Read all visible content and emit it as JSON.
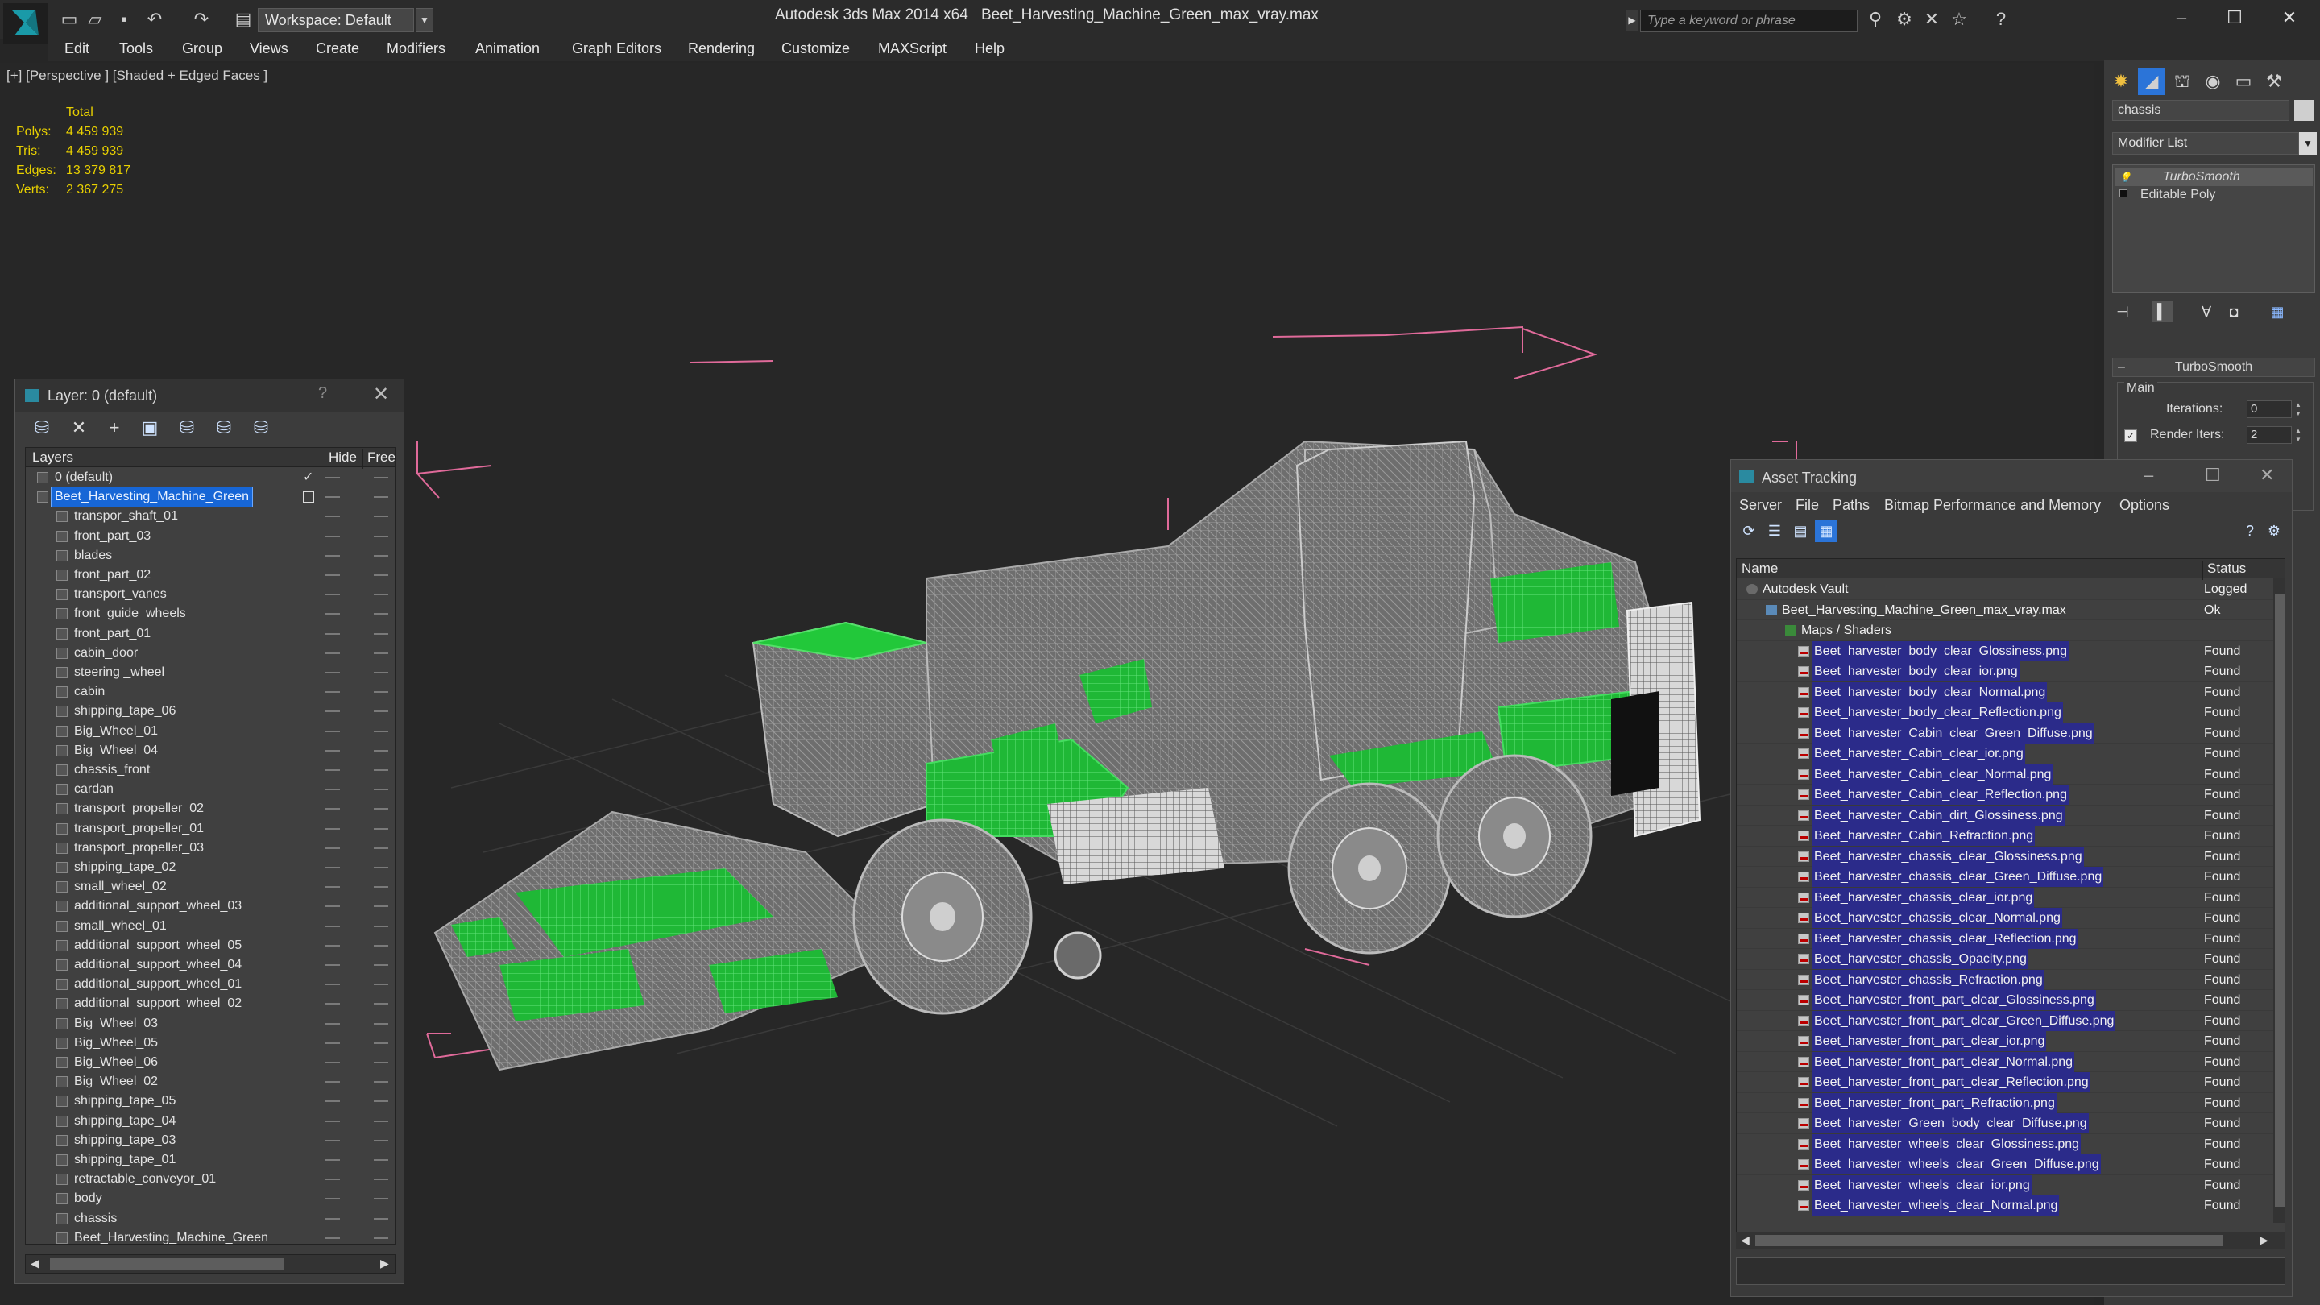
{
  "titlebar": {
    "workspace": "Workspace: Default",
    "app_title": "Autodesk 3ds Max  2014 x64",
    "file_title": "Beet_Harvesting_Machine_Green_max_vray.max",
    "search_placeholder": "Type a keyword or phrase"
  },
  "menu": [
    "Edit",
    "Tools",
    "Group",
    "Views",
    "Create",
    "Modifiers",
    "Animation",
    "Graph Editors",
    "Rendering",
    "Customize",
    "MAXScript",
    "Help"
  ],
  "viewport": {
    "label": "[+] [Perspective ] [Shaded + Edged Faces ]",
    "stats": {
      "header": "Total",
      "rows": [
        {
          "k": "Polys:",
          "v": "4 459 939"
        },
        {
          "k": "Tris:",
          "v": "4 459 939"
        },
        {
          "k": "Edges:",
          "v": "13 379 817"
        },
        {
          "k": "Verts:",
          "v": "2 367 275"
        }
      ]
    }
  },
  "layer_panel": {
    "title": "Layer: 0 (default)",
    "help": "?",
    "columns": {
      "layers": "Layers",
      "hide": "Hide",
      "freeze": "Free:"
    },
    "default_layer": "0 (default)",
    "selected_layer": "Beet_Harvesting_Machine_Green",
    "objects": [
      "transpor_shaft_01",
      "front_part_03",
      "blades",
      "front_part_02",
      "transport_vanes",
      "front_guide_wheels",
      "front_part_01",
      "cabin_door",
      "steering _wheel",
      "cabin",
      "shipping_tape_06",
      "Big_Wheel_01",
      "Big_Wheel_04",
      "chassis_front",
      "cardan",
      "transport_propeller_02",
      "transport_propeller_01",
      "transport_propeller_03",
      "shipping_tape_02",
      "small_wheel_02",
      "additional_support_wheel_03",
      "small_wheel_01",
      "additional_support_wheel_05",
      "additional_support_wheel_04",
      "additional_support_wheel_01",
      "additional_support_wheel_02",
      "Big_Wheel_03",
      "Big_Wheel_05",
      "Big_Wheel_06",
      "Big_Wheel_02",
      "shipping_tape_05",
      "shipping_tape_04",
      "shipping_tape_03",
      "shipping_tape_01",
      "retractable_conveyor_01",
      "body",
      "chassis",
      "Beet_Harvesting_Machine_Green"
    ]
  },
  "command_panel": {
    "object_name": "chassis",
    "modifier_list": "Modifier List",
    "stack": [
      "TurboSmooth",
      "Editable Poly"
    ],
    "rollout_title": "TurboSmooth",
    "group_main": "Main",
    "iterations_label": "Iterations:",
    "iterations_value": "0",
    "render_iters_label": "Render Iters:",
    "render_iters_value": "2",
    "render_iters_checked": true
  },
  "asset_tracking": {
    "title": "Asset Tracking",
    "menu": [
      "Server",
      "File",
      "Paths",
      "Bitmap Performance and Memory",
      "Options"
    ],
    "columns": {
      "name": "Name",
      "status": "Status"
    },
    "vault": {
      "name": "Autodesk Vault",
      "status": "Logged"
    },
    "max_file": {
      "name": "Beet_Harvesting_Machine_Green_max_vray.max",
      "status": "Ok"
    },
    "maps_folder": "Maps / Shaders",
    "files": [
      {
        "name": "Beet_harvester_body_clear_Glossiness.png",
        "status": "Found"
      },
      {
        "name": "Beet_harvester_body_clear_ior.png",
        "status": "Found"
      },
      {
        "name": "Beet_harvester_body_clear_Normal.png",
        "status": "Found"
      },
      {
        "name": "Beet_harvester_body_clear_Reflection.png",
        "status": "Found"
      },
      {
        "name": "Beet_harvester_Cabin_clear_Green_Diffuse.png",
        "status": "Found"
      },
      {
        "name": "Beet_harvester_Cabin_clear_ior.png",
        "status": "Found"
      },
      {
        "name": "Beet_harvester_Cabin_clear_Normal.png",
        "status": "Found"
      },
      {
        "name": "Beet_harvester_Cabin_clear_Reflection.png",
        "status": "Found"
      },
      {
        "name": "Beet_harvester_Cabin_dirt_Glossiness.png",
        "status": "Found"
      },
      {
        "name": "Beet_harvester_Cabin_Refraction.png",
        "status": "Found"
      },
      {
        "name": "Beet_harvester_chassis_clear_Glossiness.png",
        "status": "Found"
      },
      {
        "name": "Beet_harvester_chassis_clear_Green_Diffuse.png",
        "status": "Found"
      },
      {
        "name": "Beet_harvester_chassis_clear_ior.png",
        "status": "Found"
      },
      {
        "name": "Beet_harvester_chassis_clear_Normal.png",
        "status": "Found"
      },
      {
        "name": "Beet_harvester_chassis_clear_Reflection.png",
        "status": "Found"
      },
      {
        "name": "Beet_harvester_chassis_Opacity.png",
        "status": "Found"
      },
      {
        "name": "Beet_harvester_chassis_Refraction.png",
        "status": "Found"
      },
      {
        "name": "Beet_harvester_front_part_clear_Glossiness.png",
        "status": "Found"
      },
      {
        "name": "Beet_harvester_front_part_clear_Green_Diffuse.png",
        "status": "Found"
      },
      {
        "name": "Beet_harvester_front_part_clear_ior.png",
        "status": "Found"
      },
      {
        "name": "Beet_harvester_front_part_clear_Normal.png",
        "status": "Found"
      },
      {
        "name": "Beet_harvester_front_part_clear_Reflection.png",
        "status": "Found"
      },
      {
        "name": "Beet_harvester_front_part_Refraction.png",
        "status": "Found"
      },
      {
        "name": "Beet_harvester_Green_body_clear_Diffuse.png",
        "status": "Found"
      },
      {
        "name": "Beet_harvester_wheels_clear_Glossiness.png",
        "status": "Found"
      },
      {
        "name": "Beet_harvester_wheels_clear_Green_Diffuse.png",
        "status": "Found"
      },
      {
        "name": "Beet_harvester_wheels_clear_ior.png",
        "status": "Found"
      },
      {
        "name": "Beet_harvester_wheels_clear_Normal.png",
        "status": "Found"
      }
    ]
  },
  "colors": {
    "accent": "#1766d6",
    "stats_yellow": "#e8d000",
    "wire_green": "#22c83a",
    "bbox_pink": "#e06a9a"
  }
}
